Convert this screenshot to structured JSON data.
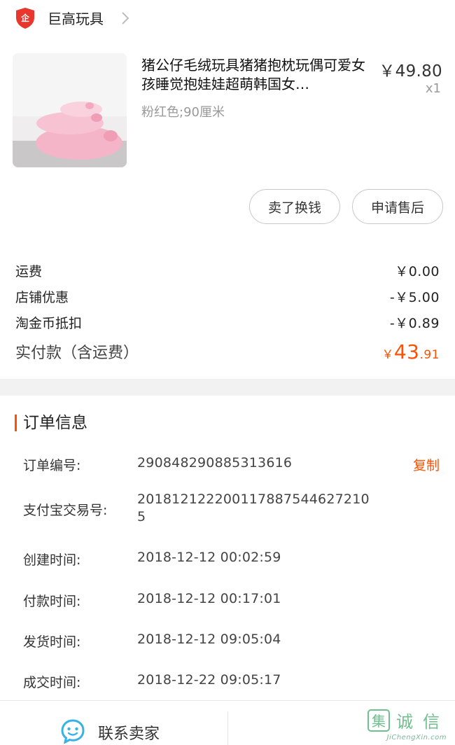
{
  "shop": {
    "name": "巨高玩具",
    "logo_icon": "shop-shield-icon",
    "logo_char": "企"
  },
  "product": {
    "title": "猪公仔毛绒玩具猪猪抱枕玩偶可爱女孩睡觉抱娃娃超萌韩国女…",
    "price": "￥49.80",
    "quantity": "x1",
    "sku": "粉红色;90厘米",
    "image_icon": "pink-pig-plush-image"
  },
  "actions": {
    "sell": "卖了换钱",
    "after_sale": "申请售后"
  },
  "summary": {
    "shipping_label": "运费",
    "shipping_value": "￥0.00",
    "shop_discount_label": "店铺优惠",
    "shop_discount_value": "-￥5.00",
    "coin_label": "淘金币抵扣",
    "coin_value": "-￥0.89",
    "total_label": "实付款（含运费）",
    "total_symbol": "￥",
    "total_int": "43",
    "total_dec": ".91"
  },
  "order_info": {
    "title": "订单信息",
    "copy": "复制",
    "rows": [
      {
        "label": "订单编号:",
        "value": "290848290885313616"
      },
      {
        "label": "支付宝交易号:",
        "value": "201812122200117887544627210",
        "value2": "5"
      },
      {
        "label": "创建时间:",
        "value": "2018-12-12 00:02:59"
      },
      {
        "label": "付款时间:",
        "value": "2018-12-12 00:17:01"
      },
      {
        "label": "发货时间:",
        "value": "2018-12-12 09:05:04"
      },
      {
        "label": "成交时间:",
        "value": "2018-12-22 09:05:17"
      }
    ]
  },
  "bottom": {
    "contact_label": "联系卖家",
    "contact_icon": "chat-bubble-icon"
  },
  "watermark": {
    "chars": "集诚信",
    "url": "JiChengXin.com"
  },
  "colors": {
    "accent": "#ff5000",
    "gap": "#f3f2f3",
    "shop_red": "#e8372d",
    "contact_blue": "#38b2e6"
  }
}
